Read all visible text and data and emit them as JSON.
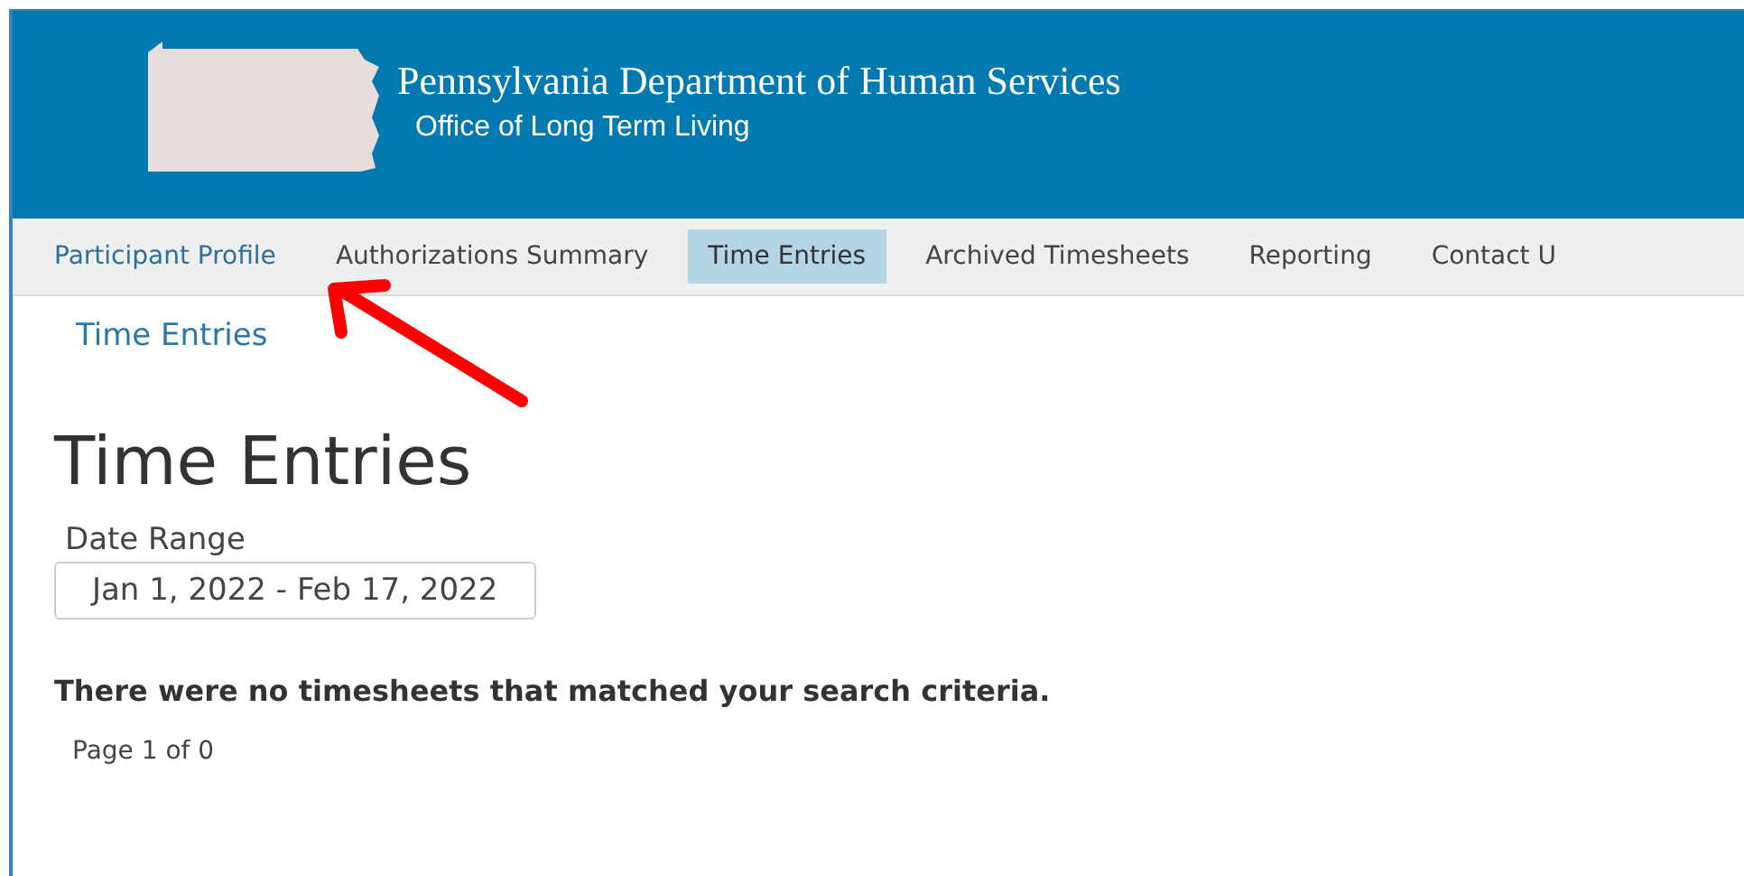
{
  "header": {
    "title": "Pennsylvania Department of Human Services",
    "subtitle": "Office of Long Term Living"
  },
  "nav": [
    {
      "label": "Participant Profile",
      "selected": false,
      "hovered": true
    },
    {
      "label": "Authorizations Summary",
      "selected": false,
      "hovered": false
    },
    {
      "label": "Time Entries",
      "selected": true,
      "hovered": false
    },
    {
      "label": "Archived Timesheets",
      "selected": false,
      "hovered": false
    },
    {
      "label": "Reporting",
      "selected": false,
      "hovered": false
    },
    {
      "label": "Contact U",
      "selected": false,
      "hovered": false
    }
  ],
  "breadcrumb": "Time Entries",
  "heading": "Time Entries",
  "date_range": {
    "label": "Date Range",
    "value": "Jan 1, 2022 - Feb 17, 2022"
  },
  "message": "There were no timesheets that matched your search criteria.",
  "pagination": "Page 1 of 0"
}
